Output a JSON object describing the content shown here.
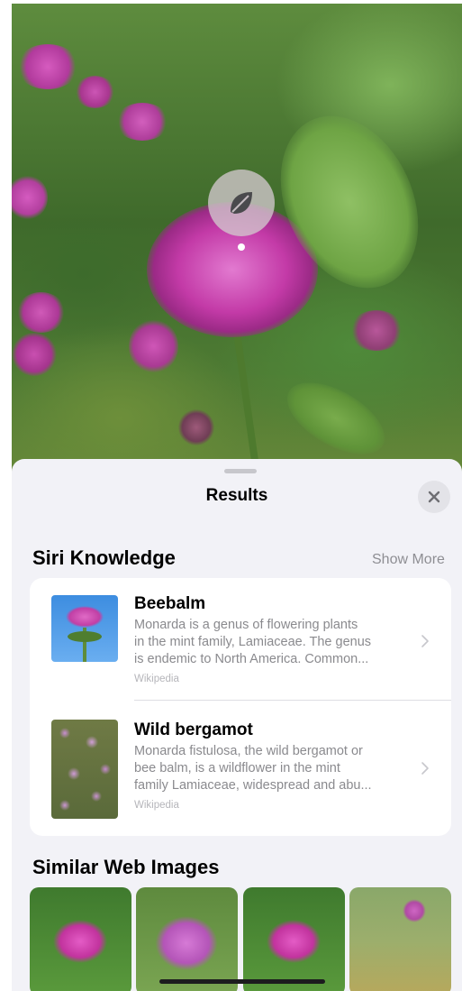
{
  "sheet": {
    "title": "Results",
    "close_icon": "xmark-icon"
  },
  "siri_knowledge": {
    "section_title": "Siri Knowledge",
    "show_more_label": "Show More",
    "items": [
      {
        "title": "Beebalm",
        "description_lines": [
          "Monarda is a genus of flowering plants",
          "in the mint family, Lamiaceae. The genus",
          "is endemic to North America. Common..."
        ],
        "source": "Wikipedia"
      },
      {
        "title": "Wild bergamot",
        "description_lines": [
          "Monarda fistulosa, the wild bergamot or",
          "bee balm, is a wildflower in the mint",
          "family Lamiaceae, widespread and abu..."
        ],
        "source": "Wikipedia"
      }
    ]
  },
  "similar_web_images": {
    "section_title": "Similar Web Images"
  },
  "lens": {
    "icon": "leaf-icon"
  },
  "colors": {
    "sheet_background": "#f2f2f7",
    "card_background": "#ffffff",
    "secondary_text": "#8a8a8e",
    "flower_pink": "#c33aa7"
  }
}
